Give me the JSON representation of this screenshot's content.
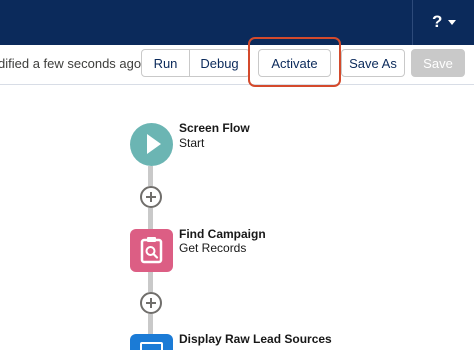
{
  "header": {
    "help_glyph": "?",
    "background": "#0b2a5b"
  },
  "toolbar": {
    "status_text": "dified a few seconds ago",
    "run_label": "Run",
    "debug_label": "Debug",
    "activate_label": "Activate",
    "save_as_label": "Save As",
    "save_label": "Save",
    "highlight_color": "#d44a2c"
  },
  "flow": {
    "nodes": [
      {
        "title": "Screen Flow",
        "subtitle": "Start",
        "icon": "play-icon",
        "color": "#6bb5b3"
      },
      {
        "title": "Find Campaign",
        "subtitle": "Get Records",
        "icon": "clipboard-search-icon",
        "color": "#dc5e84"
      },
      {
        "title": "Display Raw Lead Sources",
        "subtitle": "",
        "icon": "screen-icon",
        "color": "#1b7bd6"
      }
    ],
    "add_element_icon": "add-circle-icon"
  }
}
